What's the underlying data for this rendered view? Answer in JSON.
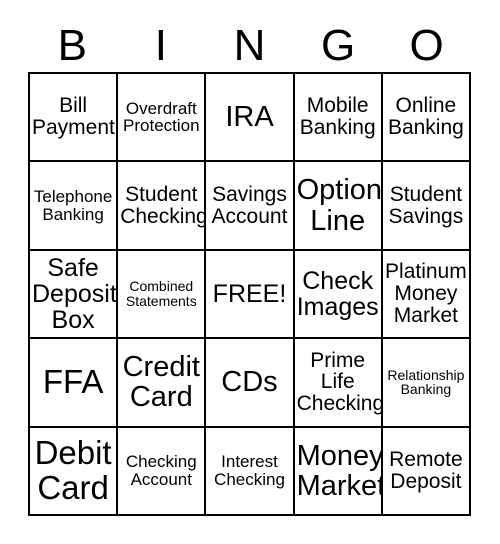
{
  "card": {
    "header_letters": [
      "B",
      "I",
      "N",
      "G",
      "O"
    ],
    "columns": 5,
    "rows": 5,
    "colors": {
      "background": "#ffffff",
      "text": "#000000",
      "border": "#000000"
    },
    "cells": [
      {
        "text": "Bill\nPayment",
        "size": "md"
      },
      {
        "text": "Overdraft\nProtection",
        "size": "sm"
      },
      {
        "text": "IRA",
        "size": "xl"
      },
      {
        "text": "Mobile\nBanking",
        "size": "md"
      },
      {
        "text": "Online\nBanking",
        "size": "md"
      },
      {
        "text": "Telephone\nBanking",
        "size": "sm"
      },
      {
        "text": "Student\nChecking",
        "size": "md"
      },
      {
        "text": "Savings\nAccount",
        "size": "md"
      },
      {
        "text": "Option\nLine",
        "size": "xl"
      },
      {
        "text": "Student\nSavings",
        "size": "md"
      },
      {
        "text": "Safe\nDeposit\nBox",
        "size": "lg"
      },
      {
        "text": "Combined\nStatements",
        "size": "xs"
      },
      {
        "text": "FREE!",
        "size": "lg"
      },
      {
        "text": "Check\nImages",
        "size": "lg"
      },
      {
        "text": "Platinum\nMoney\nMarket",
        "size": "md"
      },
      {
        "text": "FFA",
        "size": "xxl"
      },
      {
        "text": "Credit\nCard",
        "size": "xl"
      },
      {
        "text": "CDs",
        "size": "xl"
      },
      {
        "text": "Prime\nLife\nChecking",
        "size": "md"
      },
      {
        "text": "Relationship\nBanking",
        "size": "xs"
      },
      {
        "text": "Debit\nCard",
        "size": "xxl"
      },
      {
        "text": "Checking\nAccount",
        "size": "sm"
      },
      {
        "text": "Interest\nChecking",
        "size": "sm"
      },
      {
        "text": "Money\nMarket",
        "size": "xl"
      },
      {
        "text": "Remote\nDeposit",
        "size": "md"
      }
    ]
  }
}
